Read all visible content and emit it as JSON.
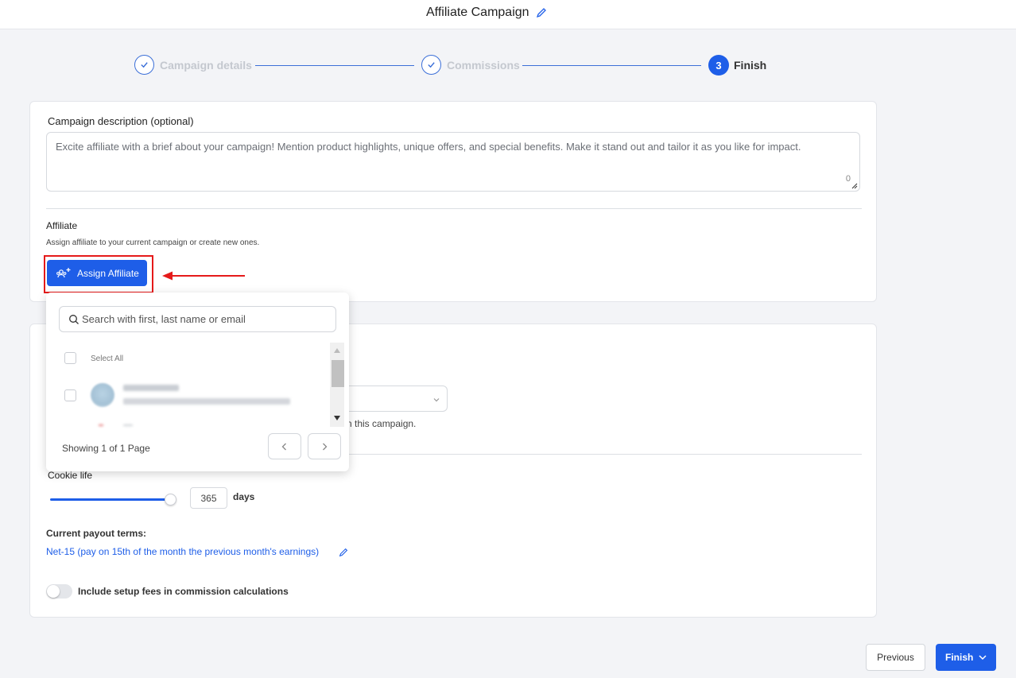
{
  "header": {
    "title": "Affiliate Campaign",
    "edit_icon": "pencil-icon"
  },
  "stepper": {
    "steps": [
      {
        "label": "Campaign details",
        "state": "done"
      },
      {
        "label": "Commissions",
        "state": "done"
      },
      {
        "number": "3",
        "label": "Finish",
        "state": "active"
      }
    ]
  },
  "description": {
    "label": "Campaign description (optional)",
    "placeholder": "Excite affiliate with a brief about your campaign! Mention product highlights, unique offers, and special benefits. Make it stand out and tailor it as you like for impact.",
    "char_count": "0"
  },
  "affiliate": {
    "title": "Affiliate",
    "help": "Assign affiliate to your current campaign or create new ones.",
    "assign_button": "Assign Affiliate"
  },
  "dropdown": {
    "search_placeholder": "Search with first, last name or email",
    "select_all": "Select All",
    "showing": "Showing 1 of 1 Page"
  },
  "settings": {
    "partial_text": "n this campaign.",
    "cookie_label": "Cookie life",
    "cookie_days": "365",
    "days_label": "days",
    "cookie_slider_fraction": 1.0,
    "payout_label": "Current payout terms:",
    "payout_value": "Net-15 (pay on 15th of the month the previous month's earnings)",
    "setup_fees_label": "Include setup fees in commission calculations",
    "setup_fees_on": false
  },
  "footer": {
    "previous": "Previous",
    "finish": "Finish"
  },
  "colors": {
    "primary": "#1e5ee8",
    "highlight": "#e51a1a"
  }
}
